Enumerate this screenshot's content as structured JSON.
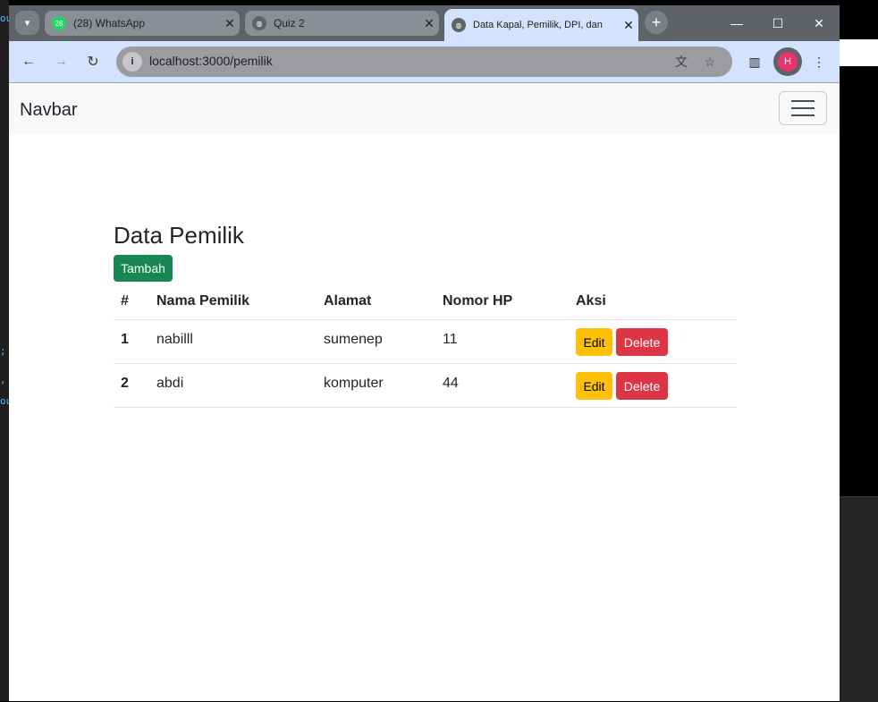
{
  "background": {
    "left_marks": [
      "ou",
      ";",
      ",",
      "ou"
    ]
  },
  "browser": {
    "tabs": [
      {
        "title": "(28) WhatsApp",
        "badge": "28",
        "icon": "whatsapp-icon"
      },
      {
        "title": "Quiz 2",
        "icon": "globe-icon"
      },
      {
        "title": "Data Kapal, Pemilik, DPI, dan",
        "icon": "globe-icon",
        "active": true
      }
    ],
    "close_glyph": "✕",
    "url": "localhost:3000/pemilik",
    "profile_initial": "H"
  },
  "colors": {
    "tab_active": "#d3e3fd",
    "tab_inactive": "#8a8f96",
    "success": "#198754",
    "warning": "#ffc107",
    "danger": "#dc3545"
  },
  "navbar": {
    "brand": "Navbar"
  },
  "main": {
    "title": "Data Pemilik",
    "add_label": "Tambah",
    "columns": [
      "#",
      "Nama Pemilik",
      "Alamat",
      "Nomor HP",
      "Aksi"
    ],
    "rows": [
      {
        "no": "1",
        "nama": "nabilll",
        "alamat": "sumenep",
        "hp": "11"
      },
      {
        "no": "2",
        "nama": "abdi",
        "alamat": "komputer",
        "hp": "44"
      }
    ],
    "edit_label": "Edit",
    "delete_label": "Delete"
  }
}
